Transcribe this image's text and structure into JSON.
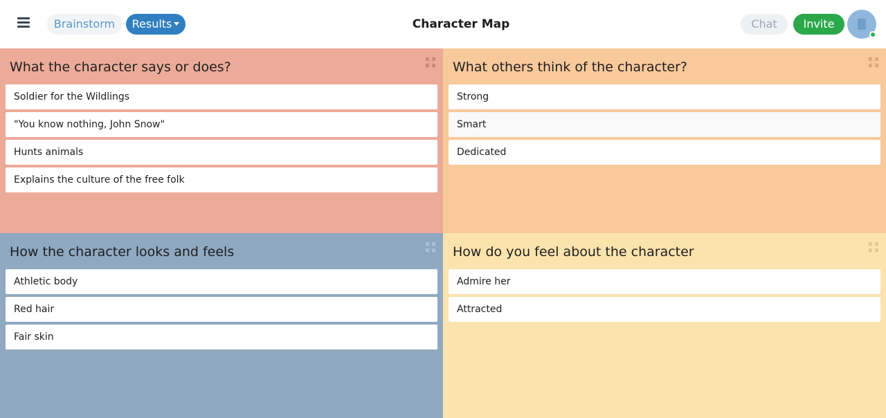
{
  "header": {
    "title": "Character Map",
    "steps": {
      "brainstorm": "Brainstorm",
      "results": "Results"
    },
    "chat_label": "Chat",
    "invite_label": "Invite"
  },
  "colors": {
    "accent_blue": "#2f7fc1",
    "invite_green": "#2aa84a",
    "quadrant_1": "#ecab98",
    "quadrant_2": "#f8c99b",
    "quadrant_3": "#8fa9c1",
    "quadrant_4": "#fbe3ad"
  },
  "icons": {
    "menu": "hamburger-menu-icon",
    "expand": "expand-arrows-icon",
    "avatar": "clipboard-avatar-icon"
  },
  "quadrants": [
    {
      "title": "What the character says or does?",
      "cards": [
        "Soldier for the Wildlings",
        "\"You know nothing, John Snow\"",
        "Hunts animals",
        "Explains the culture of the free folk"
      ]
    },
    {
      "title": "What others think of the character?",
      "cards": [
        "Strong",
        "Smart",
        "Dedicated"
      ]
    },
    {
      "title": "How the character looks and feels",
      "cards": [
        "Athletic body",
        "Red hair",
        "Fair skin"
      ]
    },
    {
      "title": "How do you feel about the character",
      "cards": [
        "Admire her",
        "Attracted"
      ]
    }
  ]
}
